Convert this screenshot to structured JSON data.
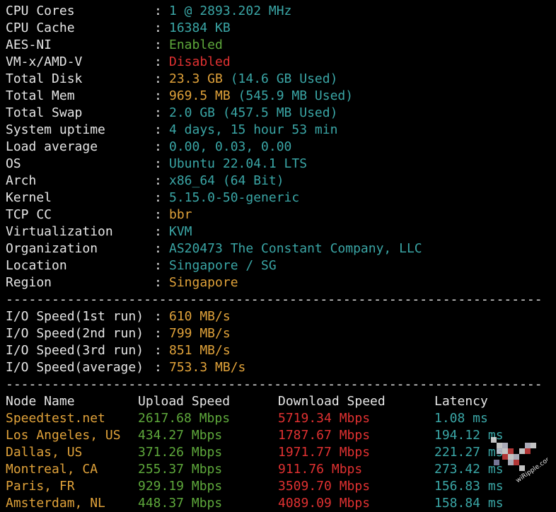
{
  "sysinfo": [
    {
      "label": "CPU Cores",
      "value": "1 @ 2893.202 MHz",
      "color": "cyan"
    },
    {
      "label": "CPU Cache",
      "value": "16384 KB",
      "color": "cyan"
    },
    {
      "label": "AES-NI",
      "value": "Enabled",
      "color": "green"
    },
    {
      "label": "VM-x/AMD-V",
      "value": "Disabled",
      "color": "red"
    },
    {
      "label": "Total Disk",
      "value": "23.3 GB",
      "value2": " (14.6 GB Used)",
      "color": "yellow",
      "color2": "cyan"
    },
    {
      "label": "Total Mem",
      "value": "969.5 MB",
      "value2": " (545.9 MB Used)",
      "color": "yellow",
      "color2": "cyan"
    },
    {
      "label": "Total Swap",
      "value": "2.0 GB (457.5 MB Used)",
      "color": "cyan"
    },
    {
      "label": "System uptime",
      "value": "4 days, 15 hour 53 min",
      "color": "cyan"
    },
    {
      "label": "Load average",
      "value": "0.00, 0.03, 0.00",
      "color": "cyan"
    },
    {
      "label": "OS",
      "value": "Ubuntu 22.04.1 LTS",
      "color": "cyan"
    },
    {
      "label": "Arch",
      "value": "x86_64 (64 Bit)",
      "color": "cyan"
    },
    {
      "label": "Kernel",
      "value": "5.15.0-50-generic",
      "color": "cyan"
    },
    {
      "label": "TCP CC",
      "value": "bbr",
      "color": "yellow"
    },
    {
      "label": "Virtualization",
      "value": "KVM",
      "color": "cyan"
    },
    {
      "label": "Organization",
      "value": "AS20473 The Constant Company, LLC",
      "color": "cyan"
    },
    {
      "label": "Location",
      "value": "Singapore / SG",
      "color": "cyan"
    },
    {
      "label": "Region",
      "value": "Singapore",
      "color": "yellow"
    }
  ],
  "separator_char": ":",
  "divider": "----------------------------------------------------------------------",
  "io": [
    {
      "label": "I/O Speed(1st run)",
      "value": "610 MB/s"
    },
    {
      "label": "I/O Speed(2nd run)",
      "value": "799 MB/s"
    },
    {
      "label": "I/O Speed(3rd run)",
      "value": "851 MB/s"
    },
    {
      "label": "I/O Speed(average)",
      "value": "753.3 MB/s"
    }
  ],
  "speedtest": {
    "headers": [
      "Node Name",
      "Upload Speed",
      "Download Speed",
      "Latency"
    ],
    "rows": [
      {
        "node": "Speedtest.net",
        "upload": "2617.68 Mbps",
        "download": "5719.34 Mbps",
        "latency": "1.08 ms"
      },
      {
        "node": "Los Angeles, US",
        "upload": "434.27 Mbps",
        "download": "1787.67 Mbps",
        "latency": "194.12 ms"
      },
      {
        "node": "Dallas, US",
        "upload": "371.26 Mbps",
        "download": "1971.77 Mbps",
        "latency": "221.27 ms"
      },
      {
        "node": "Montreal, CA",
        "upload": "255.37 Mbps",
        "download": "911.76 Mbps",
        "latency": "273.42 ms"
      },
      {
        "node": "Paris, FR",
        "upload": "929.19 Mbps",
        "download": "3509.70 Mbps",
        "latency": "156.83 ms"
      },
      {
        "node": "Amsterdam, NL",
        "upload": "448.37 Mbps",
        "download": "4089.09 Mbps",
        "latency": "158.84 ms"
      }
    ]
  },
  "colors": {
    "background": "#000000",
    "text": "#e6e6e6",
    "cyan": "#3aa6a6",
    "green": "#5ea83b",
    "red": "#e03131",
    "yellow": "#e0a23a"
  },
  "watermark": {
    "text": "wiRipple.com",
    "icon": "pixel-bird-logo-icon"
  }
}
